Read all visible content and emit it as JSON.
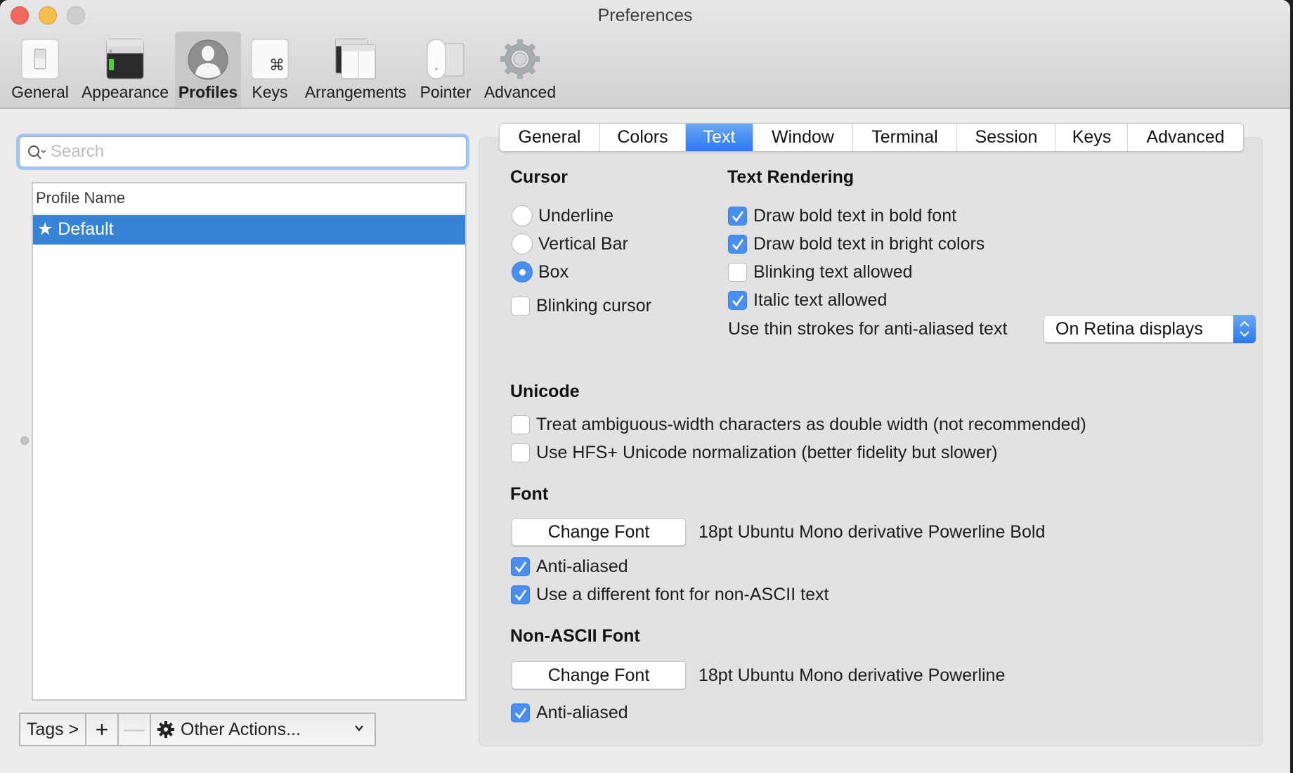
{
  "window": {
    "title": "Preferences"
  },
  "toolbar": {
    "items": [
      {
        "label": "General",
        "icon": "general-switch-icon",
        "selected": false
      },
      {
        "label": "Appearance",
        "icon": "appearance-window-icon",
        "selected": false
      },
      {
        "label": "Profiles",
        "icon": "profile-silhouette-icon",
        "selected": true
      },
      {
        "label": "Keys",
        "icon": "command-key-icon",
        "selected": false
      },
      {
        "label": "Arrangements",
        "icon": "arrangements-windows-icon",
        "selected": false
      },
      {
        "label": "Pointer",
        "icon": "mouse-icon",
        "selected": false
      },
      {
        "label": "Advanced",
        "icon": "gear-icon",
        "selected": false
      }
    ]
  },
  "sidebar": {
    "search": {
      "placeholder": "Search",
      "value": ""
    },
    "list": {
      "column_header": "Profile Name",
      "rows": [
        {
          "name": "Default",
          "default_marker": "★",
          "selected": true
        }
      ]
    },
    "bottom_bar": {
      "tags_label": "Tags >",
      "add_label": "+",
      "remove_label": "—",
      "other_actions_label": "Other Actions..."
    }
  },
  "tabs": [
    {
      "label": "General",
      "active": false
    },
    {
      "label": "Colors",
      "active": false
    },
    {
      "label": "Text",
      "active": true
    },
    {
      "label": "Window",
      "active": false
    },
    {
      "label": "Terminal",
      "active": false
    },
    {
      "label": "Session",
      "active": false
    },
    {
      "label": "Keys",
      "active": false
    },
    {
      "label": "Advanced",
      "active": false
    }
  ],
  "cursor": {
    "heading": "Cursor",
    "options": [
      {
        "label": "Underline",
        "selected": false
      },
      {
        "label": "Vertical Bar",
        "selected": false
      },
      {
        "label": "Box",
        "selected": true
      }
    ],
    "blinking": {
      "label": "Blinking cursor",
      "checked": false
    }
  },
  "text_rendering": {
    "heading": "Text Rendering",
    "options": [
      {
        "label": "Draw bold text in bold font",
        "checked": true
      },
      {
        "label": "Draw bold text in bright colors",
        "checked": true
      },
      {
        "label": "Blinking text allowed",
        "checked": false
      },
      {
        "label": "Italic text allowed",
        "checked": true
      }
    ],
    "thin_strokes": {
      "label": "Use thin strokes for anti-aliased text",
      "value": "On Retina displays"
    }
  },
  "unicode": {
    "heading": "Unicode",
    "options": [
      {
        "label": "Treat ambiguous-width characters as double width (not recommended)",
        "checked": false
      },
      {
        "label": "Use HFS+ Unicode normalization (better fidelity but slower)",
        "checked": false
      }
    ]
  },
  "font": {
    "heading": "Font",
    "button_label": "Change Font",
    "current": "18pt Ubuntu Mono derivative Powerline Bold",
    "options": [
      {
        "label": "Anti-aliased",
        "checked": true
      },
      {
        "label": "Use a different font for non-ASCII text",
        "checked": true
      }
    ]
  },
  "non_ascii_font": {
    "heading": "Non-ASCII Font",
    "button_label": "Change Font",
    "current": "18pt Ubuntu Mono derivative Powerline",
    "options": [
      {
        "label": "Anti-aliased",
        "checked": true
      }
    ]
  },
  "colors": {
    "accent": "#2b78f0",
    "selection": "#3783d8",
    "checkbox_on": "#4a8ef0"
  }
}
